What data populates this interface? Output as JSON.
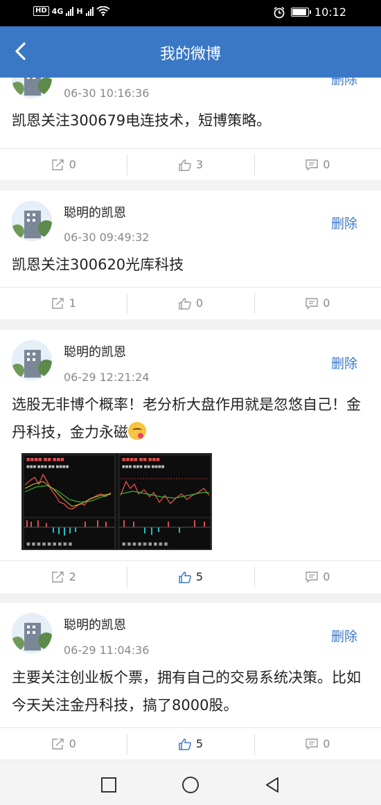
{
  "status_bar": {
    "network_left": "HD",
    "signal_1": "4G",
    "signal_2": "H",
    "time": "10:12"
  },
  "header": {
    "title": "我的微博",
    "back_icon": "chevron-left-icon"
  },
  "posts": [
    {
      "author": "",
      "time": "06-30 10:16:36",
      "delete_label": "删除",
      "content": "凯恩关注300679电连技术，短博策略。",
      "has_image": false,
      "share_count": "0",
      "like_count": "3",
      "comment_count": "0",
      "liked": false
    },
    {
      "author": "聪明的凯恩",
      "time": "06-30 09:49:32",
      "delete_label": "删除",
      "content": "凯恩关注300620光库科技",
      "has_image": false,
      "share_count": "1",
      "like_count": "0",
      "comment_count": "0",
      "liked": false
    },
    {
      "author": "聪明的凯恩",
      "time": "06-29 12:21:24",
      "delete_label": "删除",
      "content": "选股无非博个概率！老分析大盘作用就是忽悠自己！金丹科技，金力永磁",
      "has_image": true,
      "share_count": "2",
      "like_count": "5",
      "comment_count": "0",
      "liked": true
    },
    {
      "author": "聪明的凯恩",
      "time": "06-29 11:04:36",
      "delete_label": "删除",
      "content": "主要关注创业板个票，拥有自己的交易系统决策。比如今天关注金丹科技，搞了8000股。",
      "has_image": false,
      "share_count": "0",
      "like_count": "5",
      "comment_count": "0",
      "liked": true
    }
  ],
  "colors": {
    "accent": "#3a78c6",
    "text_primary": "#222222",
    "text_secondary": "#888888"
  }
}
